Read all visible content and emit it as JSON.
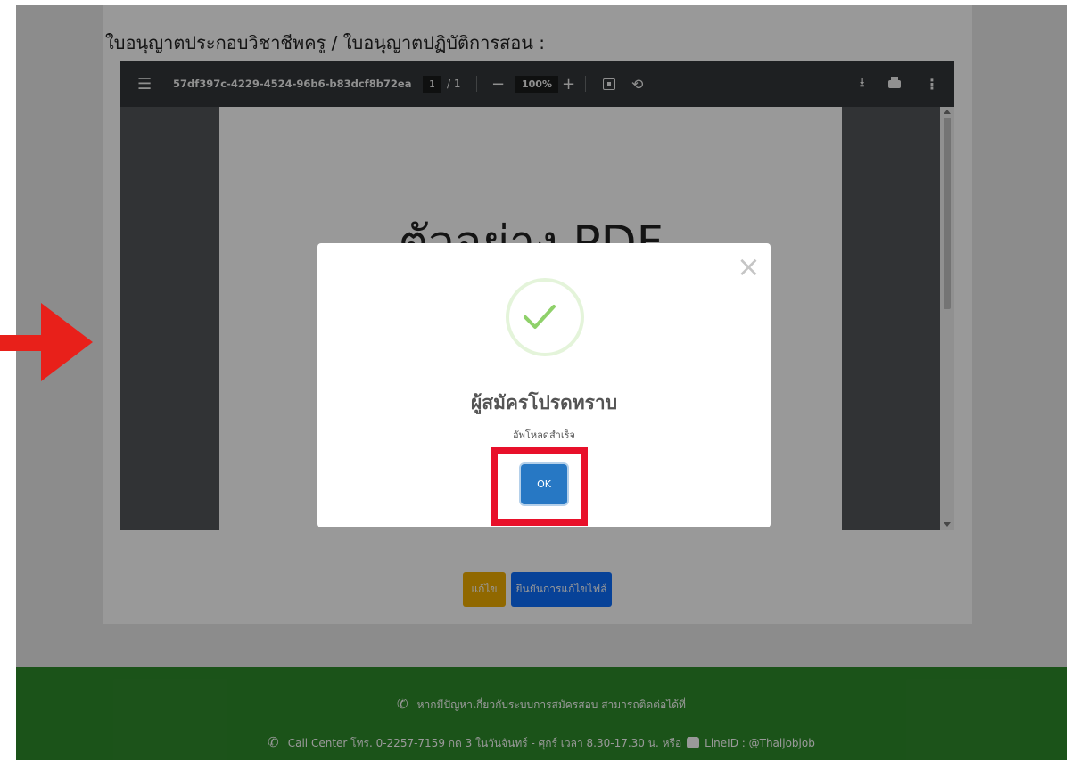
{
  "page": {
    "heading": "ใบอนุญาตประกอบวิชาชีพครู / ใบอนุญาตปฏิบัติการสอน :"
  },
  "pdf_viewer": {
    "filename": "57df397c-4229-4524-96b6-b83dcf8b72ea",
    "current_page": "1",
    "total_pages": "/ 1",
    "zoom": "100%",
    "zoom_out_symbol": "−",
    "zoom_in_symbol": "+",
    "page_title": "ตัวอย่าง PDF"
  },
  "actions": {
    "edit_label": "แก้ไข",
    "confirm_label": "ยืนยันการแก้ไขไฟล์"
  },
  "modal": {
    "title": "ผู้สมัครโปรดทราบ",
    "message": "อัพโหลดสำเร็จ",
    "ok_label": "OK",
    "close_symbol": "×"
  },
  "footer": {
    "help_text": "หากมีปัญหาเกี่ยวกับระบบการสมัครสอบ สามารถติดต่อได้ที่",
    "contact_text": "Call Center โทร. 0-2257-7159 กด 3 ในวันจันทร์ - ศุกร์ เวลา 8.30-17.30 น. หรือ",
    "line_text": "LineID : @Thaijobjob"
  },
  "colors": {
    "footer_green": "#2e8b2b",
    "ok_blue": "#2778c4",
    "highlight_red": "#e8102a",
    "edit_yellow": "#f0ad00",
    "confirm_blue": "#0d6efd"
  },
  "icons": [
    "menu-icon",
    "rotate-icon",
    "fit-page-icon",
    "download-icon",
    "print-icon",
    "more-icon",
    "close-icon",
    "check-icon",
    "phone-icon",
    "line-icon",
    "arrow-icon"
  ]
}
